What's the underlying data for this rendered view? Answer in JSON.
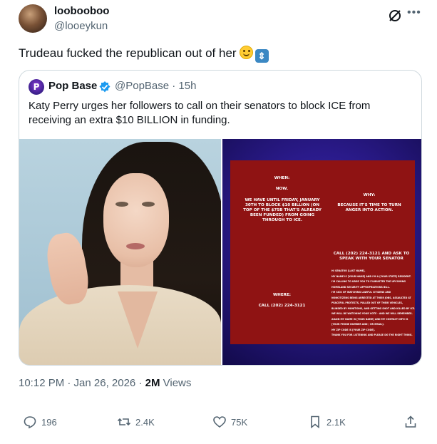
{
  "post": {
    "display_name": "loobooboo",
    "handle": "@looeykun",
    "text": "Trudeau fucked the republican out of her",
    "timestamp": "10:12 PM · Jan 26, 2026 ·",
    "views_count": "2M",
    "views_label": "Views"
  },
  "quote": {
    "display_name": "Pop Base",
    "handle_and_time": "@PopBase · 15h",
    "text": "Katy Perry urges her followers to call on their senators to block ICE from receiving an extra $10 BILLION in funding.",
    "poster": {
      "when_heading": "WHEN:",
      "now": "NOW.",
      "when_body": "WE HAVE UNTIL FRIDAY, JANUARY 30TH TO BLOCK $10 BILLION (ON TOP OF THE $75B THAT'S ALREADY BEEN FUNDED) FROM GOING THROUGH TO ICE.",
      "why_heading": "WHY:",
      "why_body": "BECAUSE IT'S TIME TO TURN ANGER INTO ACTION.",
      "call_heading": "CALL (202) 224-3121 AND ASK TO SPEAK WITH YOUR SENATOR",
      "script": [
        "HI SENATOR [LAST NAME],",
        "MY NAME IS [YOUR NAME] AND I'M A [YOUR STATE] RESIDENT.",
        "I'M CALLING TO URGE YOU TO FILIBUSTER THE UPCOMING",
        "HOMELAND SECURITY APPROPRIATIONS BILL.",
        "I'M SICK OF WATCHING LAWFUL CITIZENS AND",
        "NONCITIZENS BEING ARRESTED AT THEIR JOBS, ASSAULTED AT",
        "PEACEFUL PROTESTS, PULLED OUT OF THEIR VEHICLES,",
        "BLINDED BY MUNITIONS, AND GETTING SHOT AND KILLED BY ICE.",
        "WE WILL BE WATCHING YOUR VOTE - AND WE WILL REMEMBER.",
        "AGAIN MY NAME IS [YOUR NAME] AND MY CONTACT INFO IS",
        "[YOUR PHONE NUMBER AND / OR EMAIL].",
        "MY ZIP CODE IS [YOUR ZIP CODE].",
        "THANK YOU FOR LISTENING AND PLEASE DO THE RIGHT THING."
      ],
      "where_heading": "WHERE:",
      "where_body": "CALL (202) 224-3121"
    }
  },
  "actions": {
    "replies": "196",
    "reposts": "2.4K",
    "likes": "75K",
    "bookmarks": "2.1K"
  },
  "colors": {
    "text": "#0f1419",
    "muted": "#536471",
    "verified": "#1d9bf0",
    "poster_red": "#8f1313"
  },
  "icons": [
    "grok-icon",
    "more-icon",
    "verified-icon",
    "reply-icon",
    "repost-icon",
    "like-icon",
    "bookmark-icon",
    "share-icon"
  ]
}
